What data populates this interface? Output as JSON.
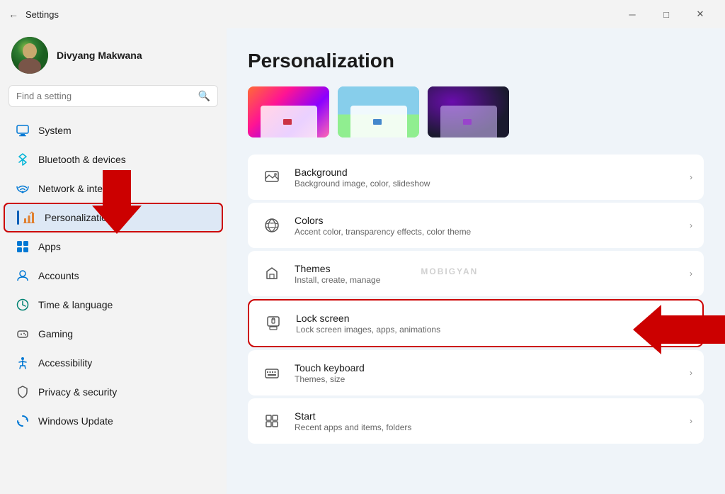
{
  "titlebar": {
    "back_icon": "←",
    "title": "Settings",
    "minimize_icon": "─",
    "maximize_icon": "□",
    "close_icon": "✕"
  },
  "sidebar": {
    "user": {
      "name": "Divyang Makwana"
    },
    "search_placeholder": "Find a setting",
    "nav_items": [
      {
        "id": "system",
        "label": "System",
        "icon": "🖥",
        "icon_class": "blue",
        "active": false
      },
      {
        "id": "bluetooth",
        "label": "Bluetooth & devices",
        "icon": "🔵",
        "icon_class": "cyan",
        "active": false
      },
      {
        "id": "network",
        "label": "Network & internet",
        "icon": "🌐",
        "icon_class": "blue",
        "active": false
      },
      {
        "id": "personalization",
        "label": "Personalization",
        "icon": "✏",
        "icon_class": "orange",
        "active": true
      },
      {
        "id": "apps",
        "label": "Apps",
        "icon": "📦",
        "icon_class": "blue",
        "active": false
      },
      {
        "id": "accounts",
        "label": "Accounts",
        "icon": "👤",
        "icon_class": "blue",
        "active": false
      },
      {
        "id": "time",
        "label": "Time & language",
        "icon": "🌍",
        "icon_class": "teal",
        "active": false
      },
      {
        "id": "gaming",
        "label": "Gaming",
        "icon": "🎮",
        "icon_class": "dark",
        "active": false
      },
      {
        "id": "accessibility",
        "label": "Accessibility",
        "icon": "♿",
        "icon_class": "blue",
        "active": false
      },
      {
        "id": "privacy",
        "label": "Privacy & security",
        "icon": "🔒",
        "icon_class": "dark",
        "active": false
      },
      {
        "id": "windows-update",
        "label": "Windows Update",
        "icon": "🔄",
        "icon_class": "blue",
        "active": false
      }
    ]
  },
  "content": {
    "page_title": "Personalization",
    "settings_items": [
      {
        "id": "background",
        "label": "Background",
        "description": "Background image, color, slideshow",
        "icon": "🖼"
      },
      {
        "id": "colors",
        "label": "Colors",
        "description": "Accent color, transparency effects, color theme",
        "icon": "🎨"
      },
      {
        "id": "themes",
        "label": "Themes",
        "description": "Install, create, manage",
        "icon": "✏"
      },
      {
        "id": "lock-screen",
        "label": "Lock screen",
        "description": "Lock screen images, apps, animations",
        "icon": "🖥",
        "highlighted": true
      },
      {
        "id": "touch-keyboard",
        "label": "Touch keyboard",
        "description": "Themes, size",
        "icon": "⌨"
      },
      {
        "id": "start",
        "label": "Start",
        "description": "Recent apps and items, folders",
        "icon": "⊞"
      }
    ],
    "watermark": "MOBIGYAN"
  }
}
